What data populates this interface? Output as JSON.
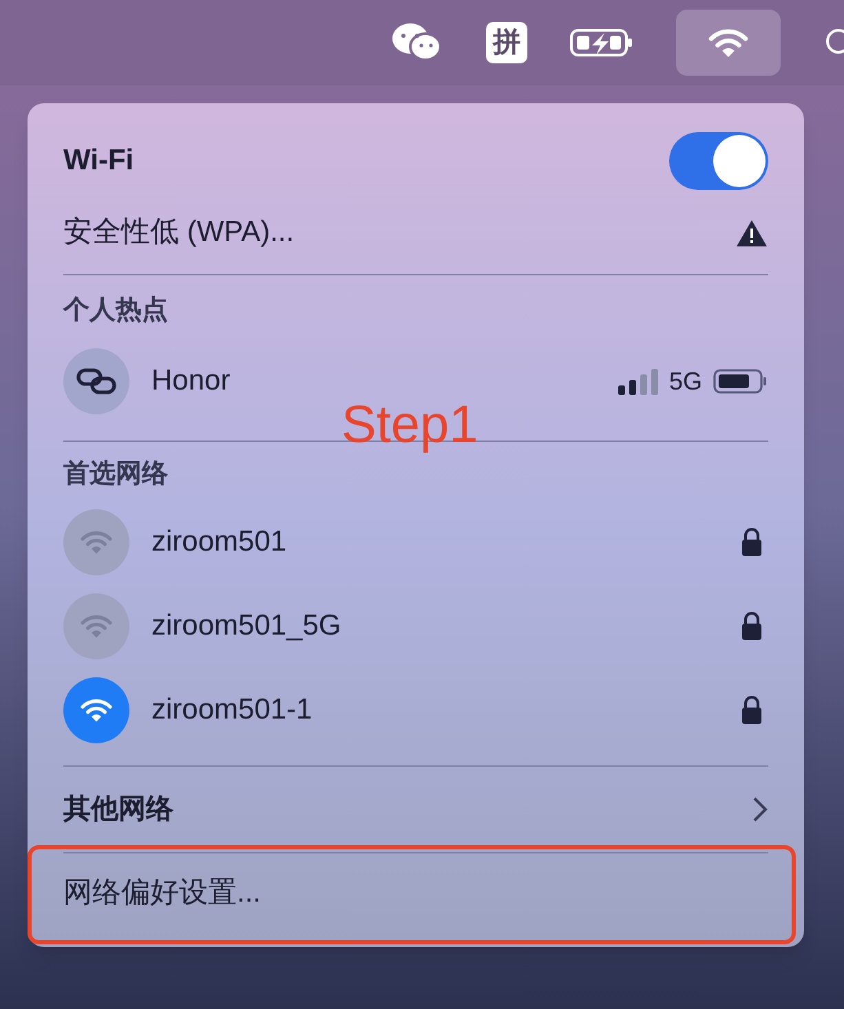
{
  "menu_bar": {
    "input_method": "拼"
  },
  "wifi": {
    "title": "Wi-Fi",
    "on": true
  },
  "warning": "安全性低 (WPA)...",
  "hotspot": {
    "title": "个人热点",
    "devices": [
      {
        "name": "Honor",
        "network": "5G"
      }
    ]
  },
  "preferred": {
    "title": "首选网络",
    "networks": [
      {
        "name": "ziroom501",
        "selected": false,
        "locked": true
      },
      {
        "name": "ziroom501_5G",
        "selected": false,
        "locked": true
      },
      {
        "name": "ziroom501-1",
        "selected": true,
        "locked": true
      }
    ]
  },
  "other_networks": "其他网络",
  "preferences": "网络偏好设置...",
  "annotation": {
    "label": "Step1",
    "highlight_preferences": true
  }
}
